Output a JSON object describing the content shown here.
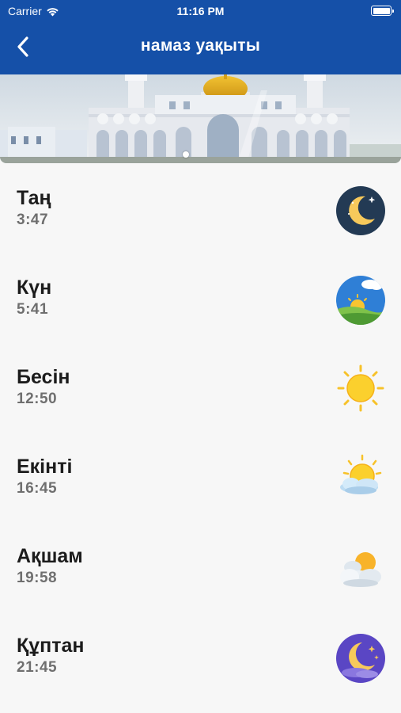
{
  "status_bar": {
    "carrier": "Carrier",
    "time": "11:16 PM"
  },
  "header": {
    "title": "намаз уақыты"
  },
  "banner": {
    "image": "mosque-banner",
    "slides_indicator": "dot"
  },
  "prayers": [
    {
      "name": "Таң",
      "time": "3:47",
      "icon": "crescent-moon-night-icon"
    },
    {
      "name": "Күн",
      "time": "5:41",
      "icon": "sunrise-landscape-icon"
    },
    {
      "name": "Бесін",
      "time": "12:50",
      "icon": "sun-icon"
    },
    {
      "name": "Екінті",
      "time": "16:45",
      "icon": "sun-behind-cloud-icon"
    },
    {
      "name": "Ақшам",
      "time": "19:58",
      "icon": "sun-clouds-evening-icon"
    },
    {
      "name": "Құптан",
      "time": "21:45",
      "icon": "moon-stars-clouds-icon"
    }
  ],
  "colors": {
    "nav": "#1550a8",
    "background": "#f7f7f7",
    "time_text": "#6f6f6f"
  }
}
